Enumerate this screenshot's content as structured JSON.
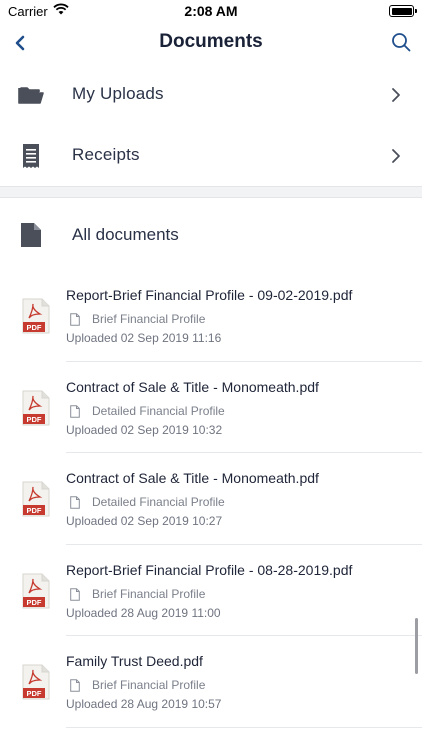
{
  "status": {
    "carrier": "Carrier",
    "time": "2:08 AM"
  },
  "nav": {
    "title": "Documents"
  },
  "menu": [
    {
      "label": "My Uploads",
      "icon": "folder-icon"
    },
    {
      "label": "Receipts",
      "icon": "receipt-icon"
    }
  ],
  "all_documents": {
    "label": "All documents",
    "icon": "document-icon"
  },
  "documents": [
    {
      "name": "Report-Brief Financial Profile - 09-02-2019.pdf",
      "category": "Brief Financial Profile",
      "uploaded": "Uploaded 02 Sep 2019 11:16"
    },
    {
      "name": "Contract of Sale & Title - Monomeath.pdf",
      "category": "Detailed Financial Profile",
      "uploaded": "Uploaded 02 Sep 2019 10:32"
    },
    {
      "name": "Contract of Sale & Title - Monomeath.pdf",
      "category": "Detailed Financial Profile",
      "uploaded": "Uploaded 02 Sep 2019 10:27"
    },
    {
      "name": "Report-Brief Financial Profile - 08-28-2019.pdf",
      "category": "Brief Financial Profile",
      "uploaded": "Uploaded 28 Aug 2019 11:00"
    },
    {
      "name": "Family Trust Deed.pdf",
      "category": "Brief Financial Profile",
      "uploaded": "Uploaded 28 Aug 2019 10:57"
    }
  ],
  "pdf_badge": "PDF",
  "colors": {
    "accent": "#1f4e8c",
    "pdf_red": "#c63a2f",
    "icon_gray": "#4a4f5a"
  }
}
